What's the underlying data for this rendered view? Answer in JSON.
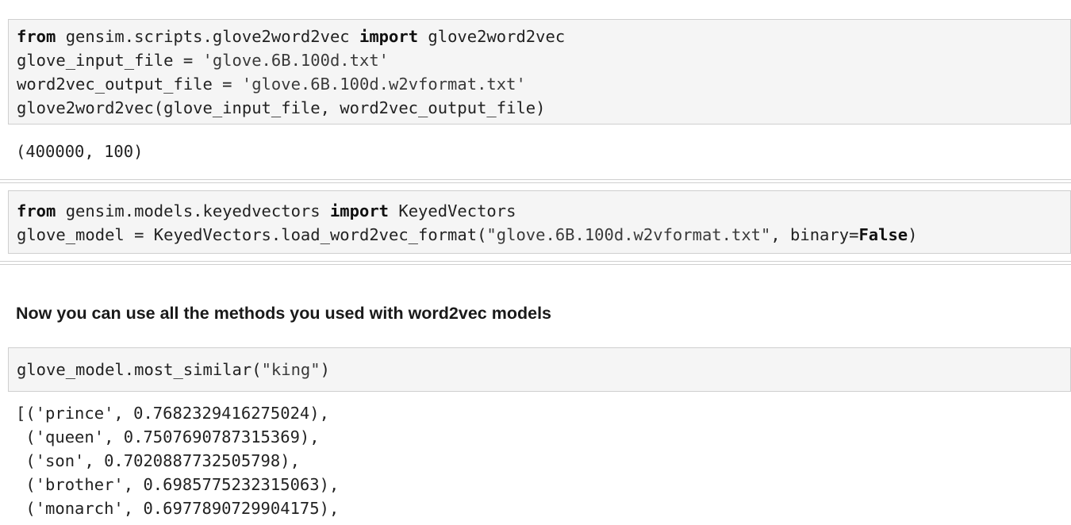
{
  "cells": [
    {
      "id": "cell1",
      "code": [
        [
          {
            "t": "from",
            "k": "kw"
          },
          {
            "t": " gensim.scripts.glove2word2vec "
          },
          {
            "t": "import",
            "k": "kw"
          },
          {
            "t": " glove2word2vec"
          }
        ],
        [
          {
            "t": "glove_input_file = "
          },
          {
            "t": "'glove.6B.100d.txt'",
            "k": "str"
          }
        ],
        [
          {
            "t": "word2vec_output_file = "
          },
          {
            "t": "'glove.6B.100d.w2vformat.txt'",
            "k": "str"
          }
        ],
        [
          {
            "t": "glove2word2vec(glove_input_file, word2vec_output_file)"
          }
        ]
      ],
      "output": [
        "(400000, 100)"
      ]
    },
    {
      "id": "cell2",
      "code": [
        [
          {
            "t": "from",
            "k": "kw"
          },
          {
            "t": " gensim.models.keyedvectors "
          },
          {
            "t": "import",
            "k": "kw"
          },
          {
            "t": " KeyedVectors"
          }
        ],
        [
          {
            "t": "glove_model = KeyedVectors.load_word2vec_format("
          },
          {
            "t": "\"glove.6B.100d.w2vformat.txt\"",
            "k": "str"
          },
          {
            "t": ", binary="
          },
          {
            "t": "False",
            "k": "kw"
          },
          {
            "t": ")"
          }
        ]
      ],
      "output": []
    },
    {
      "id": "cell3",
      "code": [
        [
          {
            "t": "glove_model.most_similar("
          },
          {
            "t": "\"king\"",
            "k": "str"
          },
          {
            "t": ")"
          }
        ]
      ],
      "output": [
        "[('prince', 0.7682329416275024),",
        " ('queen', 0.7507690787315369),",
        " ('son', 0.7020887732505798),",
        " ('brother', 0.6985775232315063),",
        " ('monarch', 0.6977890729904175),"
      ]
    }
  ],
  "markdown": {
    "heading": "Now you can use all the methods you used with word2vec models"
  }
}
